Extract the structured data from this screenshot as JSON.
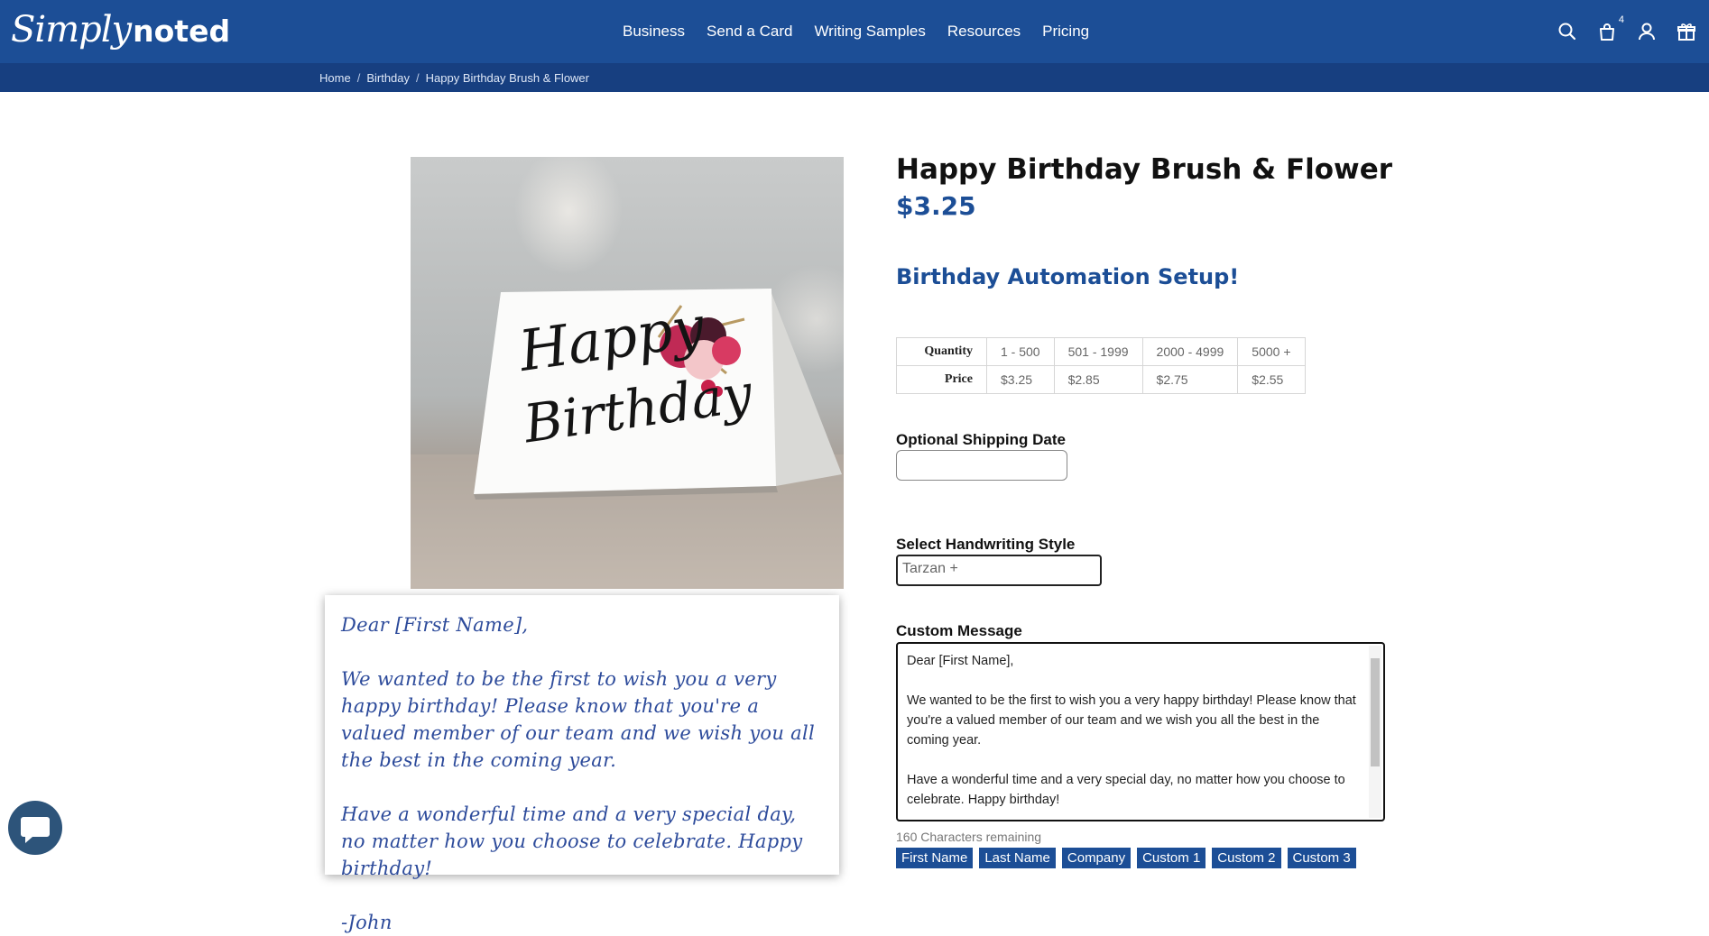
{
  "header": {
    "logo_script": "Simply",
    "logo_bold": "noted",
    "nav": [
      "Business",
      "Send a Card",
      "Writing Samples",
      "Resources",
      "Pricing"
    ],
    "cart_count": "4",
    "icons": [
      "search-icon",
      "shopping-bag-icon",
      "user-icon",
      "gift-icon"
    ]
  },
  "breadcrumb": [
    "Home",
    "Birthday",
    "Happy Birthday Brush & Flower"
  ],
  "card_image": {
    "line1": "Happy",
    "line2": "Birthday"
  },
  "preview_letter": {
    "greeting": "Dear [First Name],",
    "para1": "We wanted to be the first to wish you a very happy birthday! Please know that you're a valued member of our team and we wish you all the best in the coming year.",
    "para2": "Have a wonderful time and a very special day, no matter how you choose to celebrate. Happy birthday!",
    "signoff": "-John"
  },
  "product": {
    "title": "Happy Birthday Brush & Flower",
    "price": "$3.25",
    "subtitle": "Birthday Automation Setup!"
  },
  "pricing_table": {
    "row_labels": [
      "Quantity",
      "Price"
    ],
    "quantities": [
      "1 - 500",
      "501 - 1999",
      "2000 - 4999",
      "5000 +"
    ],
    "prices": [
      "$3.25",
      "$2.85",
      "$2.75",
      "$2.55"
    ]
  },
  "form": {
    "shipping_label": "Optional Shipping Date",
    "shipping_value": "",
    "handwriting_label": "Select Handwriting Style",
    "handwriting_value": "Tarzan +",
    "message_label": "Custom Message",
    "message_lines": [
      "Dear [First Name],",
      "",
      "We wanted to be the first to wish you a very happy birthday! Please know that you're a valued member of our team and we wish you all the best in the coming year.",
      "",
      "Have a wonderful time and a very special day, no matter how you choose to celebrate. Happy birthday!"
    ],
    "chars_remaining": "160 Characters remaining",
    "tags": [
      "First Name",
      "Last Name",
      "Company",
      "Custom 1",
      "Custom 2",
      "Custom 3"
    ]
  },
  "colors": {
    "brand_blue": "#1c4e96",
    "dark_blue": "#173f80",
    "ink_blue": "#2d4b9b"
  }
}
